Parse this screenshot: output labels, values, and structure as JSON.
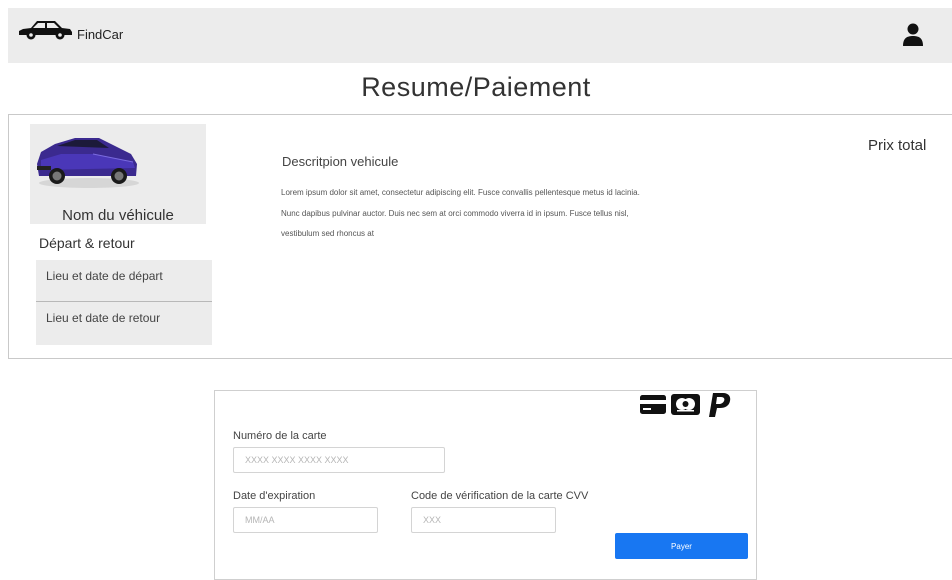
{
  "header": {
    "brand": "FindCar",
    "logo_icon": "car-icon",
    "user_icon": "user-icon",
    "background": "#ececec"
  },
  "page_title": "Resume/Paiement",
  "summary": {
    "vehicle_name": "Nom du véhicule",
    "vehicle_image": "purple-hatchback-car",
    "departure_return_title": "Départ & retour",
    "departure_label": "Lieu et date de départ",
    "return_label": "Lieu et date de retour",
    "description_title": "Descritpion vehicule",
    "description_lines": [
      "Lorem ipsum dolor sit amet, consectetur adipiscing elit. Fusce convallis pellentesque metus id lacinia.",
      "Nunc dapibus pulvinar auctor. Duis nec sem at orci commodo viverra id in ipsum. Fusce tellus nisl,",
      "vestibulum sed rhoncus at"
    ],
    "total_price_label": "Prix total"
  },
  "payment": {
    "icons": [
      "credit-card-icon",
      "mastercard-icon",
      "paypal-icon"
    ],
    "card_number_label": "Numéro de la carte",
    "card_number_placeholder": "XXXX XXXX XXXX XXXX",
    "expiry_label": "Date d'expiration",
    "expiry_placeholder": "MM/AA",
    "cvv_label": "Code de vérification de la carte CVV",
    "cvv_placeholder": "XXX",
    "pay_button_label": "Payer",
    "pay_button_color": "#1877f2"
  }
}
